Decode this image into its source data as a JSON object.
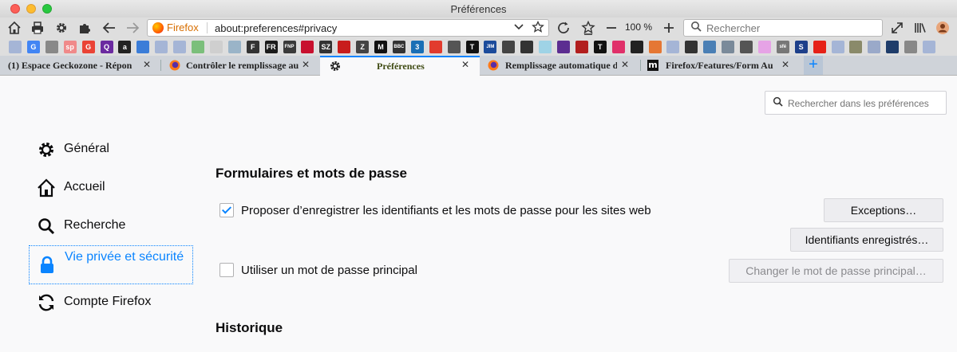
{
  "window": {
    "title": "Préférences"
  },
  "toolbar": {
    "identity_label": "Firefox",
    "url": "about:preferences#privacy",
    "zoom": "100 %",
    "search_placeholder": "Rechercher"
  },
  "bookmarks": [
    {
      "icon": "folder-icon",
      "color": "#a5b5d6",
      "text": ""
    },
    {
      "icon": "google-icon",
      "color": "#4285f4",
      "text": "G"
    },
    {
      "icon": "apple-icon",
      "color": "#888888",
      "text": ""
    },
    {
      "icon": "sp-icon",
      "color": "#f08a8a",
      "text": "sp"
    },
    {
      "icon": "google-icon",
      "color": "#ea4335",
      "text": "G"
    },
    {
      "icon": "qwant-icon",
      "color": "#6b2aa0",
      "text": "Q"
    },
    {
      "icon": "amazon-icon",
      "color": "#222222",
      "text": "a"
    },
    {
      "icon": "bird-icon",
      "color": "#3b7dd8",
      "text": ""
    },
    {
      "icon": "folder-icon",
      "color": "#a5b5d6",
      "text": ""
    },
    {
      "icon": "folder-icon",
      "color": "#a5b5d6",
      "text": ""
    },
    {
      "icon": "folder-icon",
      "color": "#7bbf7b",
      "text": ""
    },
    {
      "icon": "site-icon",
      "color": "#cfcfcf",
      "text": ""
    },
    {
      "icon": "site-icon",
      "color": "#9ab4c8",
      "text": ""
    },
    {
      "icon": "newspaper-icon",
      "color": "#333333",
      "text": "F"
    },
    {
      "icon": "fr-icon",
      "color": "#1b1b1b",
      "text": "FR"
    },
    {
      "icon": "fnp-icon",
      "color": "#3a3a3a",
      "text": "FNP"
    },
    {
      "icon": "flag-icon",
      "color": "#c8102e",
      "text": ""
    },
    {
      "icon": "sz-icon",
      "color": "#333333",
      "text": "SZ"
    },
    {
      "icon": "spiegel-icon",
      "color": "#c81d1d",
      "text": ""
    },
    {
      "icon": "z-icon",
      "color": "#444444",
      "text": "Z"
    },
    {
      "icon": "m-icon",
      "color": "#111111",
      "text": "M"
    },
    {
      "icon": "bbc-icon",
      "color": "#333333",
      "text": "BBC"
    },
    {
      "icon": "three-icon",
      "color": "#1a6fb5",
      "text": "3"
    },
    {
      "icon": "ring-icon",
      "color": "#e23b2e",
      "text": ""
    },
    {
      "icon": "sax-icon",
      "color": "#555555",
      "text": ""
    },
    {
      "icon": "nyt-icon",
      "color": "#111111",
      "text": "T"
    },
    {
      "icon": "jim-icon",
      "color": "#1c4b9b",
      "text": "JIM"
    },
    {
      "icon": "site-icon",
      "color": "#444444",
      "text": ""
    },
    {
      "icon": "pin-icon",
      "color": "#333333",
      "text": ""
    },
    {
      "icon": "folder-icon",
      "color": "#9fd3e6",
      "text": ""
    },
    {
      "icon": "bein-icon",
      "color": "#5c2d91",
      "text": ""
    },
    {
      "icon": "site-icon",
      "color": "#b21e1e",
      "text": ""
    },
    {
      "icon": "t-icon",
      "color": "#111111",
      "text": "T"
    },
    {
      "icon": "site-icon",
      "color": "#e0306a",
      "text": ""
    },
    {
      "icon": "site-icon",
      "color": "#222222",
      "text": ""
    },
    {
      "icon": "site-icon",
      "color": "#e57734",
      "text": ""
    },
    {
      "icon": "folder-icon",
      "color": "#a5b5d6",
      "text": ""
    },
    {
      "icon": "corsica-icon",
      "color": "#333333",
      "text": ""
    },
    {
      "icon": "site-icon",
      "color": "#4a7fb5",
      "text": ""
    },
    {
      "icon": "site-icon",
      "color": "#7a8a9a",
      "text": ""
    },
    {
      "icon": "rail-icon",
      "color": "#555555",
      "text": ""
    },
    {
      "icon": "folder-icon",
      "color": "#e6a3e6",
      "text": ""
    },
    {
      "icon": "sfe-icon",
      "color": "#777777",
      "text": "sfé"
    },
    {
      "icon": "s-icon",
      "color": "#1d3f8a",
      "text": "S"
    },
    {
      "icon": "youtube-icon",
      "color": "#e62117",
      "text": ""
    },
    {
      "icon": "folder-icon",
      "color": "#a5b5d6",
      "text": ""
    },
    {
      "icon": "zone-icon",
      "color": "#8a8a6a",
      "text": ""
    },
    {
      "icon": "site-icon",
      "color": "#9aa9c9",
      "text": ""
    },
    {
      "icon": "site-icon",
      "color": "#1e3c6a",
      "text": ""
    },
    {
      "icon": "apple-icon",
      "color": "#888888",
      "text": ""
    },
    {
      "icon": "folder-icon",
      "color": "#a5b5d6",
      "text": ""
    }
  ],
  "tabs": [
    {
      "title": "(1) Espace Geckozone - Répon",
      "favicon": "geckozone-icon"
    },
    {
      "title": "Contrôler le remplissage au",
      "favicon": "firefox-icon"
    },
    {
      "title": "Préférences",
      "favicon": "gear-icon"
    },
    {
      "title": "Remplissage automatique d",
      "favicon": "firefox-icon"
    },
    {
      "title": "Firefox/Features/Form Au",
      "favicon": "mozilla-icon"
    }
  ],
  "prefs": {
    "search_placeholder": "Rechercher dans les préférences",
    "categories": [
      {
        "label": "Général",
        "icon": "gear-icon"
      },
      {
        "label": "Accueil",
        "icon": "home-icon"
      },
      {
        "label": "Recherche",
        "icon": "search-icon"
      },
      {
        "label": "Vie privée et sécurité",
        "icon": "lock-icon",
        "selected": true
      },
      {
        "label": "Compte Firefox",
        "icon": "sync-icon"
      }
    ],
    "forms_heading": "Formulaires et mots de passe",
    "save_logins": {
      "label": "Proposer d’enregistrer les identifiants et les mots de passe pour les sites web",
      "checked": true
    },
    "exceptions_button": "Exceptions…",
    "saved_logins_button": "Identifiants enregistrés…",
    "master_password": {
      "label": "Utiliser un mot de passe principal",
      "checked": false
    },
    "change_master_button": "Changer le mot de passe principal…",
    "history_heading": "Historique"
  }
}
